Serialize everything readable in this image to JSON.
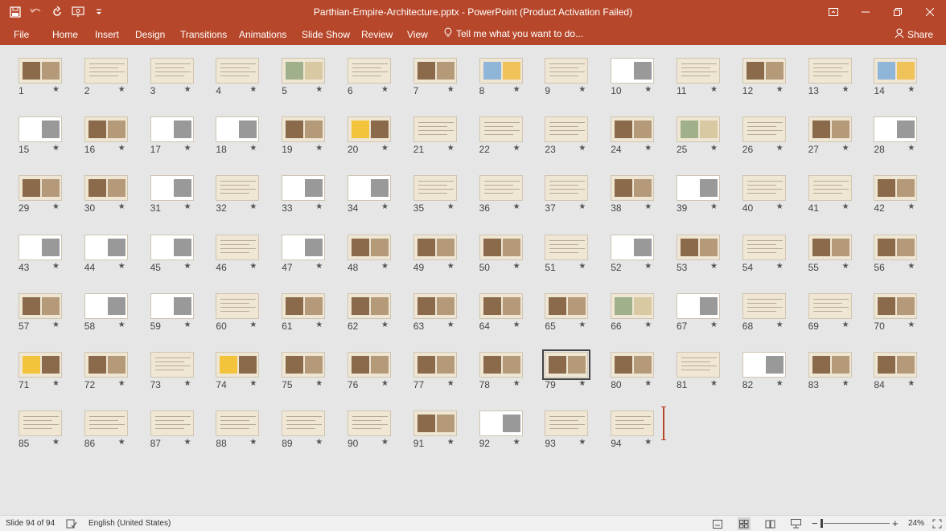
{
  "titlebar": {
    "doc_title": "Parthian-Empire-Architecture.pptx  -  PowerPoint (Product Activation Failed)",
    "icons": [
      "save-icon",
      "undo-icon",
      "redo-icon",
      "present-from-start-icon",
      "customize-qat-icon"
    ]
  },
  "ribbon": {
    "tabs": [
      "File",
      "Home",
      "Insert",
      "Design",
      "Transitions",
      "Animations",
      "Slide Show",
      "Review",
      "View"
    ],
    "tell_me": "Tell me what you want to do...",
    "share": "Share"
  },
  "sorter": {
    "total_slides": 94,
    "selected_slide": 79,
    "star_glyph": "★",
    "slides": [
      {
        "n": "1"
      },
      {
        "n": "2"
      },
      {
        "n": "3"
      },
      {
        "n": "4"
      },
      {
        "n": "5"
      },
      {
        "n": "6"
      },
      {
        "n": "7"
      },
      {
        "n": "8"
      },
      {
        "n": "9"
      },
      {
        "n": "10"
      },
      {
        "n": "11"
      },
      {
        "n": "12"
      },
      {
        "n": "13"
      },
      {
        "n": "14"
      },
      {
        "n": "15"
      },
      {
        "n": "16"
      },
      {
        "n": "17"
      },
      {
        "n": "18"
      },
      {
        "n": "19"
      },
      {
        "n": "20"
      },
      {
        "n": "21"
      },
      {
        "n": "22"
      },
      {
        "n": "23"
      },
      {
        "n": "24"
      },
      {
        "n": "25"
      },
      {
        "n": "26"
      },
      {
        "n": "27"
      },
      {
        "n": "28"
      },
      {
        "n": "29"
      },
      {
        "n": "30"
      },
      {
        "n": "31"
      },
      {
        "n": "32"
      },
      {
        "n": "33"
      },
      {
        "n": "34"
      },
      {
        "n": "35"
      },
      {
        "n": "36"
      },
      {
        "n": "37"
      },
      {
        "n": "38"
      },
      {
        "n": "39"
      },
      {
        "n": "40"
      },
      {
        "n": "41"
      },
      {
        "n": "42"
      },
      {
        "n": "43"
      },
      {
        "n": "44"
      },
      {
        "n": "45"
      },
      {
        "n": "46"
      },
      {
        "n": "47"
      },
      {
        "n": "48"
      },
      {
        "n": "49"
      },
      {
        "n": "50"
      },
      {
        "n": "51"
      },
      {
        "n": "52"
      },
      {
        "n": "53"
      },
      {
        "n": "54"
      },
      {
        "n": "55"
      },
      {
        "n": "56"
      },
      {
        "n": "57"
      },
      {
        "n": "58"
      },
      {
        "n": "59"
      },
      {
        "n": "60"
      },
      {
        "n": "61"
      },
      {
        "n": "62"
      },
      {
        "n": "63"
      },
      {
        "n": "64"
      },
      {
        "n": "65"
      },
      {
        "n": "66"
      },
      {
        "n": "67"
      },
      {
        "n": "68"
      },
      {
        "n": "69"
      },
      {
        "n": "70"
      },
      {
        "n": "71"
      },
      {
        "n": "72"
      },
      {
        "n": "73"
      },
      {
        "n": "74"
      },
      {
        "n": "75"
      },
      {
        "n": "76"
      },
      {
        "n": "77"
      },
      {
        "n": "78"
      },
      {
        "n": "79"
      },
      {
        "n": "80"
      },
      {
        "n": "81"
      },
      {
        "n": "82"
      },
      {
        "n": "83"
      },
      {
        "n": "84"
      },
      {
        "n": "85"
      },
      {
        "n": "86"
      },
      {
        "n": "87"
      },
      {
        "n": "88"
      },
      {
        "n": "89"
      },
      {
        "n": "90"
      },
      {
        "n": "91"
      },
      {
        "n": "92"
      },
      {
        "n": "93"
      },
      {
        "n": "94"
      }
    ]
  },
  "statusbar": {
    "slide_info": "Slide 94 of 94",
    "language": "English (United States)",
    "zoom": "24%",
    "zoom_percent": 24
  },
  "colors": {
    "accent": "#b7472a",
    "sorter_bg": "#e6e6e6",
    "thumb_bg": "#efe6d4",
    "status_bg": "#f0f0f0"
  }
}
